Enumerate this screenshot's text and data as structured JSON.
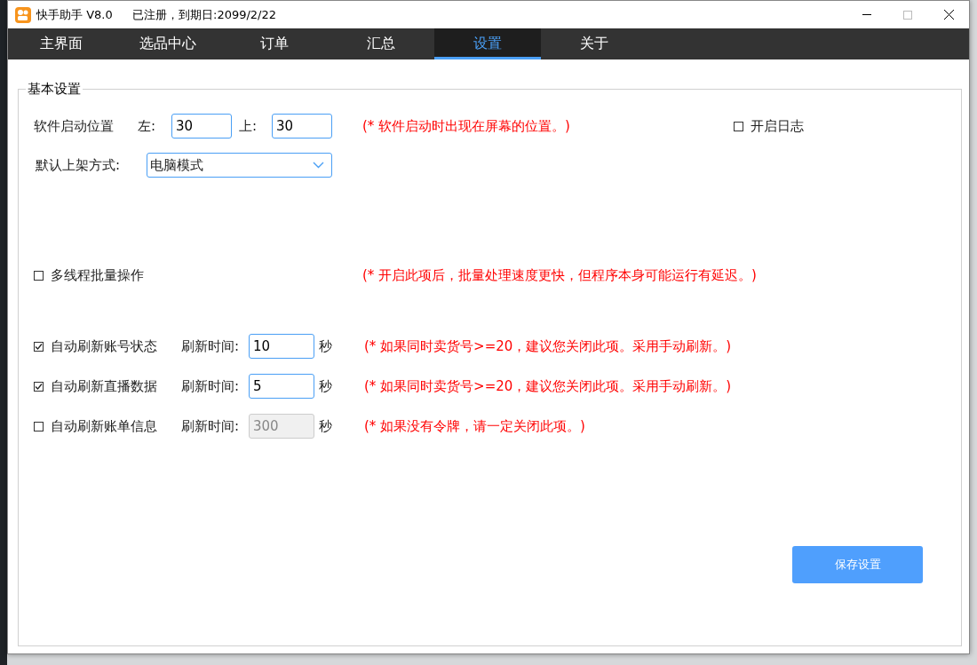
{
  "window": {
    "title": "快手助手 V8.0",
    "registration": "已注册，到期日:2099/2/22"
  },
  "tabs": [
    {
      "label": "主界面",
      "selected": false
    },
    {
      "label": "选品中心",
      "selected": false
    },
    {
      "label": "订单",
      "selected": false
    },
    {
      "label": "汇总",
      "selected": false
    },
    {
      "label": "设置",
      "selected": true
    },
    {
      "label": "关于",
      "selected": false
    }
  ],
  "settings": {
    "group_title": "基本设置",
    "startup": {
      "label": "软件启动位置",
      "left_label": "左:",
      "left_value": "30",
      "top_label": "上:",
      "top_value": "30",
      "note": "(* 软件启动时出现在屏幕的位置。)"
    },
    "log": {
      "label": "开启日志",
      "checked": false
    },
    "default_mode": {
      "label": "默认上架方式:",
      "value": "电脑模式"
    },
    "multithread": {
      "label": "多线程批量操作",
      "checked": false,
      "note": "(* 开启此项后，批量处理速度更快，但程序本身可能运行有延迟。)"
    },
    "refresh_rows": [
      {
        "label": "自动刷新账号状态",
        "checked": true,
        "time_label": "刷新时间:",
        "value": "10",
        "disabled": false,
        "unit": "秒",
        "note": "(* 如果同时卖货号>=20，建议您关闭此项。采用手动刷新。)"
      },
      {
        "label": "自动刷新直播数据",
        "checked": true,
        "time_label": "刷新时间:",
        "value": "5",
        "disabled": false,
        "unit": "秒",
        "note": "(* 如果同时卖货号>=20，建议您关闭此项。采用手动刷新。)"
      },
      {
        "label": "自动刷新账单信息",
        "checked": false,
        "time_label": "刷新时间:",
        "value": "300",
        "disabled": true,
        "unit": "秒",
        "note": "(* 如果没有令牌，请一定关闭此项。)"
      }
    ],
    "save_button": "保存设置"
  }
}
